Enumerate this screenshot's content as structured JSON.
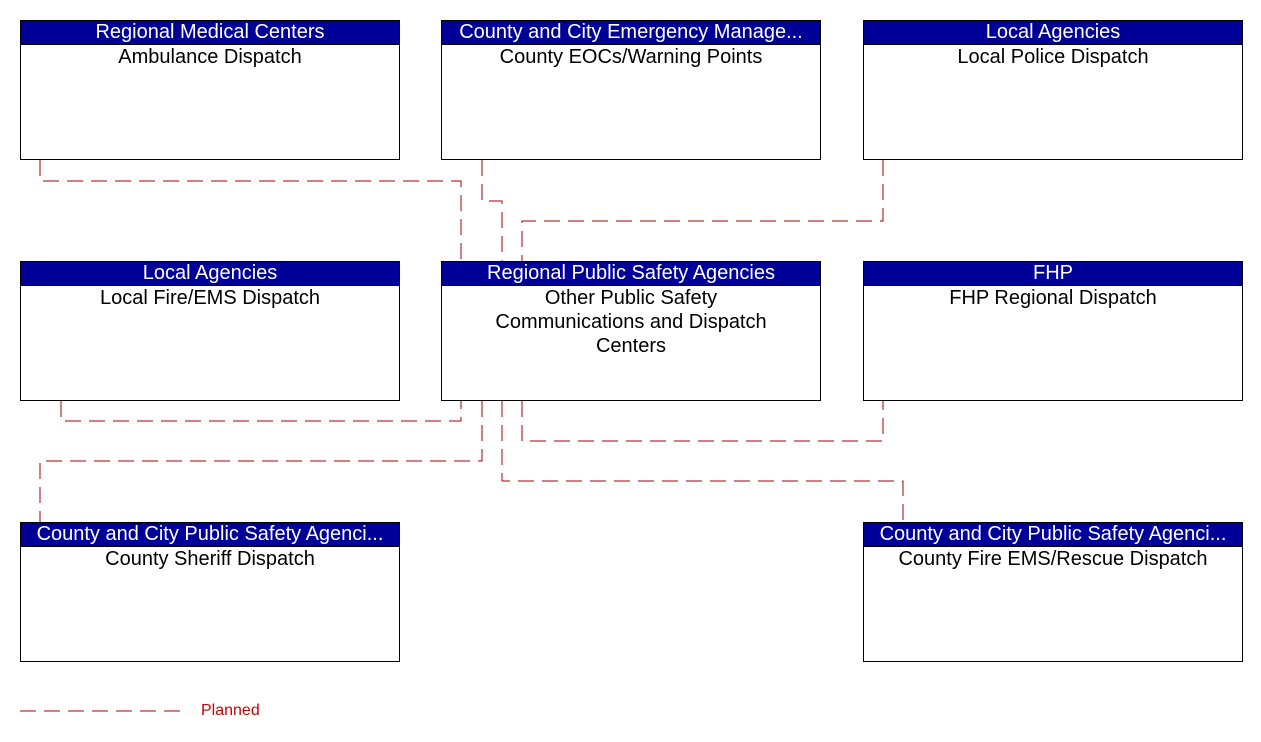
{
  "diagram": {
    "nodes": [
      {
        "id": "ambulance",
        "group": "Regional Medical Centers",
        "name": "Ambulance Dispatch"
      },
      {
        "id": "county-eoc",
        "group": "County and City Emergency Manage...",
        "name": "County EOCs/Warning Points"
      },
      {
        "id": "local-police",
        "group": "Local Agencies",
        "name": "Local Police Dispatch"
      },
      {
        "id": "local-fire",
        "group": "Local Agencies",
        "name": "Local Fire/EMS Dispatch"
      },
      {
        "id": "center",
        "group": "Regional Public Safety Agencies",
        "name": "Other Public Safety Communications and Dispatch Centers"
      },
      {
        "id": "fhp",
        "group": "FHP",
        "name": "FHP Regional Dispatch"
      },
      {
        "id": "sheriff",
        "group": "County and City Public Safety Agenci...",
        "name": "County Sheriff Dispatch"
      },
      {
        "id": "county-fire",
        "group": "County and City Public Safety Agenci...",
        "name": "County Fire EMS/Rescue Dispatch"
      }
    ],
    "connections": [
      {
        "from": "ambulance",
        "to": "center",
        "status": "Planned"
      },
      {
        "from": "county-eoc",
        "to": "center",
        "status": "Planned"
      },
      {
        "from": "local-police",
        "to": "center",
        "status": "Planned"
      },
      {
        "from": "local-fire",
        "to": "center",
        "status": "Planned"
      },
      {
        "from": "sheriff",
        "to": "center",
        "status": "Planned"
      },
      {
        "from": "county-fire",
        "to": "center",
        "status": "Planned"
      },
      {
        "from": "fhp",
        "to": "center",
        "status": "Planned"
      }
    ],
    "legend": {
      "label": "Planned",
      "color": "#aa0000"
    }
  }
}
